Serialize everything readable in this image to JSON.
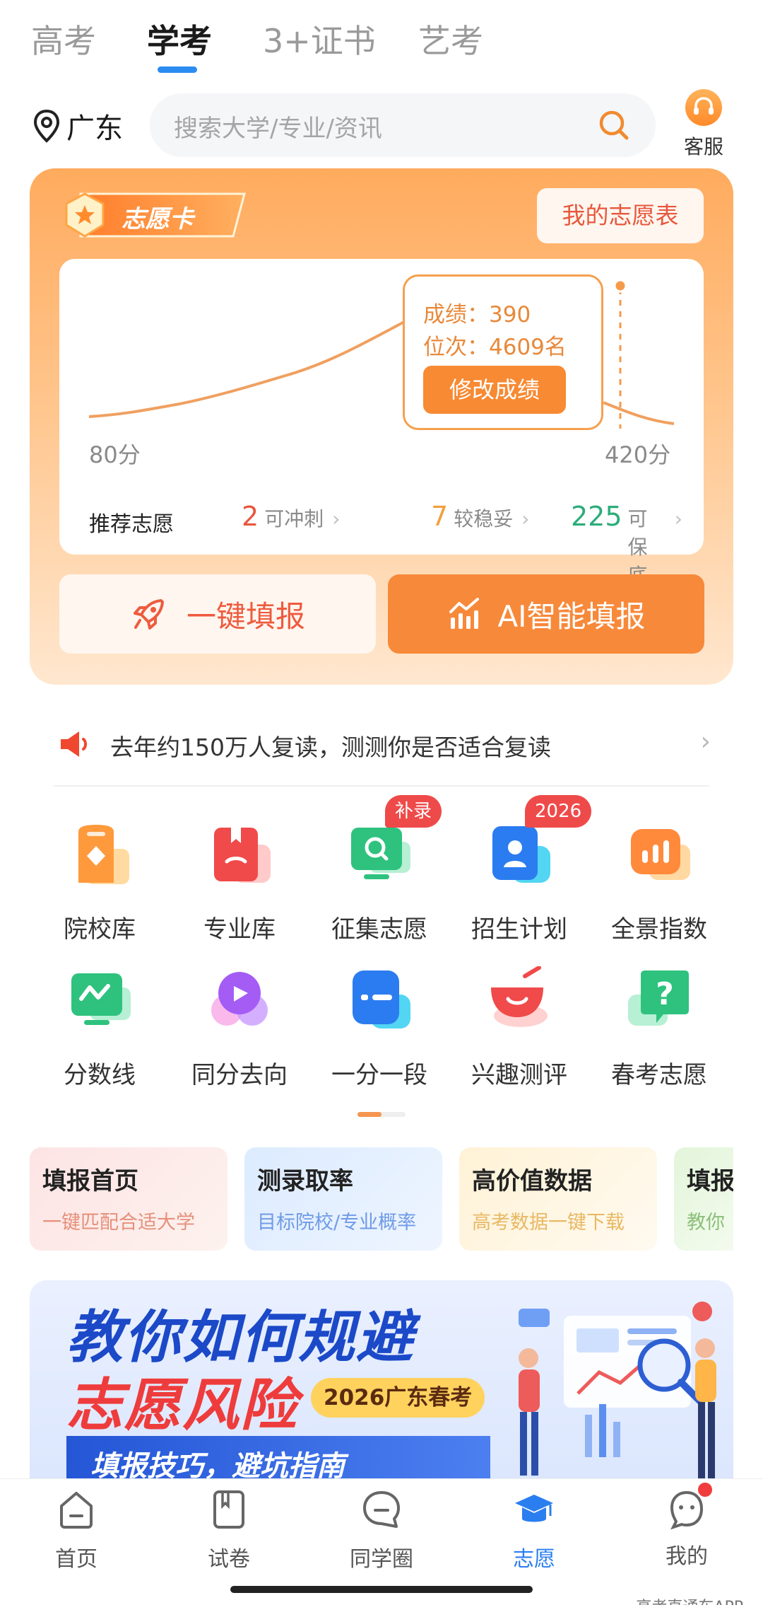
{
  "top_tabs": [
    "高考",
    "学考",
    "3+证书",
    "艺考"
  ],
  "location": "广东",
  "search": {
    "placeholder": "搜索大学/专业/资讯"
  },
  "service_label": "客服",
  "volunteer_card": {
    "badge": "志愿卡",
    "my_table_label": "我的志愿表",
    "chart": {
      "min_label": "80分",
      "max_label": "420分",
      "tooltip_score": "成绩：390",
      "tooltip_rank": "位次：4609名",
      "tooltip_button": "修改成绩"
    },
    "recommend": {
      "title": "推荐志愿",
      "items": [
        {
          "count": "2",
          "label": "可冲刺",
          "color": "#e8573d"
        },
        {
          "count": "7",
          "label": "较稳妥",
          "color": "#f0a040"
        },
        {
          "count": "225",
          "label": "可保底",
          "color": "#2cad7a"
        }
      ]
    },
    "btn_one_click": "一键填报",
    "btn_ai": "AI智能填报"
  },
  "notice": {
    "text": "去年约150万人复读，测测你是否适合复读"
  },
  "grid": [
    {
      "label": "院校库",
      "icon": "school-icon",
      "color": "#ff9a3c"
    },
    {
      "label": "专业库",
      "icon": "book-icon",
      "color": "#f04a4a"
    },
    {
      "label": "征集志愿",
      "icon": "monitor-search-icon",
      "color": "#2ec27e",
      "badge": "补录"
    },
    {
      "label": "招生计划",
      "icon": "person-card-icon",
      "color": "#2b7cf0",
      "badge": "2026"
    },
    {
      "label": "全景指数",
      "icon": "bar-stats-icon",
      "color": "#ff8a3c"
    },
    {
      "label": "分数线",
      "icon": "score-line-icon",
      "color": "#2ec27e"
    },
    {
      "label": "同分去向",
      "icon": "direction-icon",
      "color": "#a45cf5"
    },
    {
      "label": "一分一段",
      "icon": "segment-icon",
      "color": "#2b7cf0"
    },
    {
      "label": "兴趣测评",
      "icon": "cup-icon",
      "color": "#f04a4a"
    },
    {
      "label": "春考志愿",
      "icon": "question-icon",
      "color": "#2ec27e"
    }
  ],
  "features": [
    {
      "title": "填报首页",
      "sub": "一键匹配合适大学",
      "bg": "#fdeeee",
      "sub_color": "#e6907a"
    },
    {
      "title": "测录取率",
      "sub": "目标院校/专业概率",
      "bg": "#e8f1ff",
      "sub_color": "#6f9be6"
    },
    {
      "title": "高价值数据",
      "sub": "高考数据一键下载",
      "bg": "#fff7e3",
      "sub_color": "#e8b864"
    },
    {
      "title": "填报",
      "sub": "教你",
      "bg": "#eef8e8",
      "sub_color": "#8cc07a"
    }
  ],
  "banner": {
    "line1": "教你如何规避",
    "line2": "志愿风险",
    "tag": "2026广东春考",
    "strip": "填报技巧，避坑指南"
  },
  "bottom_nav": [
    {
      "label": "首页",
      "icon": "home-icon"
    },
    {
      "label": "试卷",
      "icon": "paper-icon"
    },
    {
      "label": "同学圈",
      "icon": "chat-icon"
    },
    {
      "label": "志愿",
      "icon": "graduation-cap-icon"
    },
    {
      "label": "我的",
      "icon": "profile-icon"
    }
  ],
  "watermark": "高考直通车APP"
}
